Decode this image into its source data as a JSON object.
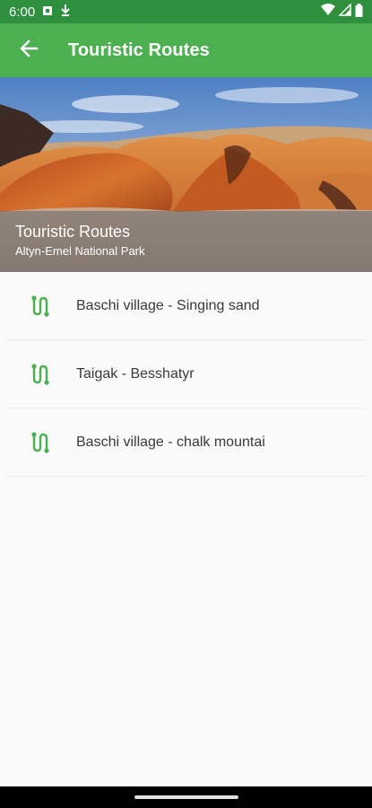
{
  "status_bar": {
    "time": "6:00",
    "icons": [
      "sim-card-icon",
      "download-icon",
      "wifi-icon",
      "signal-icon",
      "battery-icon"
    ]
  },
  "app_bar": {
    "title": "Touristic Routes",
    "back_icon": "arrow-back-icon",
    "background_color": "#4caf50"
  },
  "hero": {
    "title": "Touristic Routes",
    "subtitle": "Altyn-Emel National Park"
  },
  "routes": [
    {
      "label": "Baschi village - Singing sand",
      "icon": "route-icon"
    },
    {
      "label": "Taigak - Besshatyr",
      "icon": "route-icon"
    },
    {
      "label": "Baschi village - chalk mountai",
      "icon": "route-icon"
    }
  ],
  "colors": {
    "accent": "#4caf50",
    "status_bar": "#2e8f3e",
    "route_icon": "#4caf50"
  }
}
